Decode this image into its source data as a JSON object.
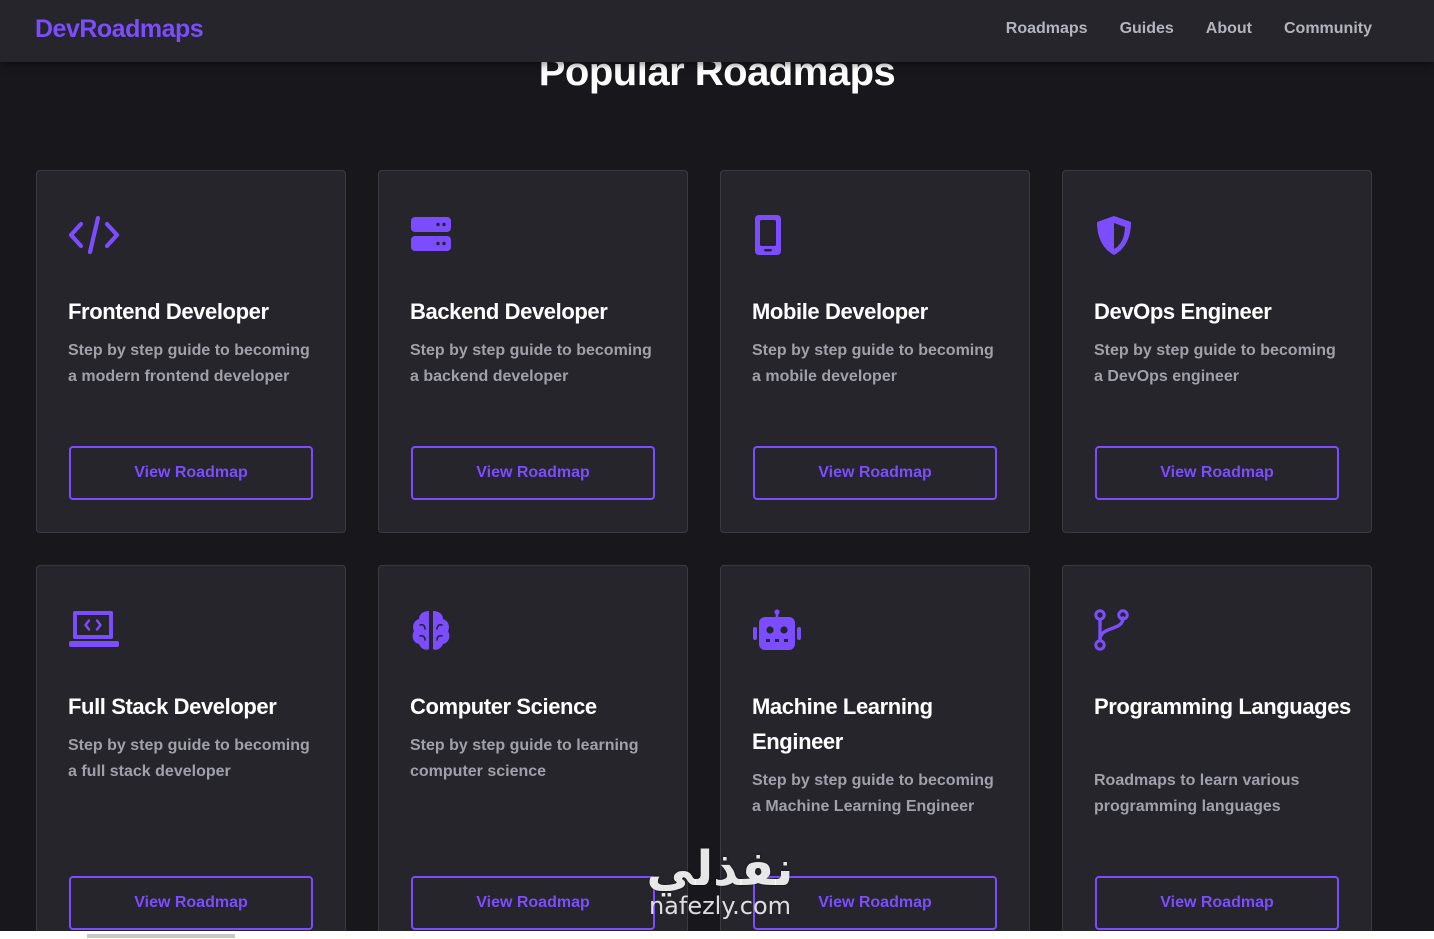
{
  "nav": {
    "brand": "DevRoadmaps",
    "links": [
      "Roadmaps",
      "Guides",
      "About",
      "Community"
    ]
  },
  "section": {
    "title": "Popular Roadmaps"
  },
  "cards": [
    {
      "icon": "code-icon",
      "title": "Frontend Developer",
      "description": "Step by step guide to becoming a modern frontend developer",
      "button": "View Roadmap"
    },
    {
      "icon": "server-icon",
      "title": "Backend Developer",
      "description": "Step by step guide to becoming a backend developer",
      "button": "View Roadmap"
    },
    {
      "icon": "mobile-icon",
      "title": "Mobile Developer",
      "description": "Step by step guide to becoming a mobile developer",
      "button": "View Roadmap"
    },
    {
      "icon": "shield-icon",
      "title": "DevOps Engineer",
      "description": "Step by step guide to becoming a DevOps engineer",
      "button": "View Roadmap"
    },
    {
      "icon": "laptop-code-icon",
      "title": "Full Stack Developer",
      "description": "Step by step guide to becoming a full stack developer",
      "button": "View Roadmap"
    },
    {
      "icon": "brain-icon",
      "title": "Computer Science",
      "description": "Step by step guide to learning computer science",
      "button": "View Roadmap"
    },
    {
      "icon": "robot-icon",
      "title": "Machine Learning Engineer",
      "description": "Step by step guide to becoming a Machine Learning Engineer",
      "button": "View Roadmap"
    },
    {
      "icon": "code-branch-icon",
      "title": "Programming Languages",
      "description": "Roadmaps to learn various programming languages",
      "button": "View Roadmap"
    }
  ],
  "watermark": {
    "arabic": "نفذلي",
    "latin": "nafezly.com"
  },
  "colors": {
    "accent": "#7c4dff",
    "background": "#18181c",
    "card": "#25252b",
    "muted_text": "#a0a0aa"
  }
}
